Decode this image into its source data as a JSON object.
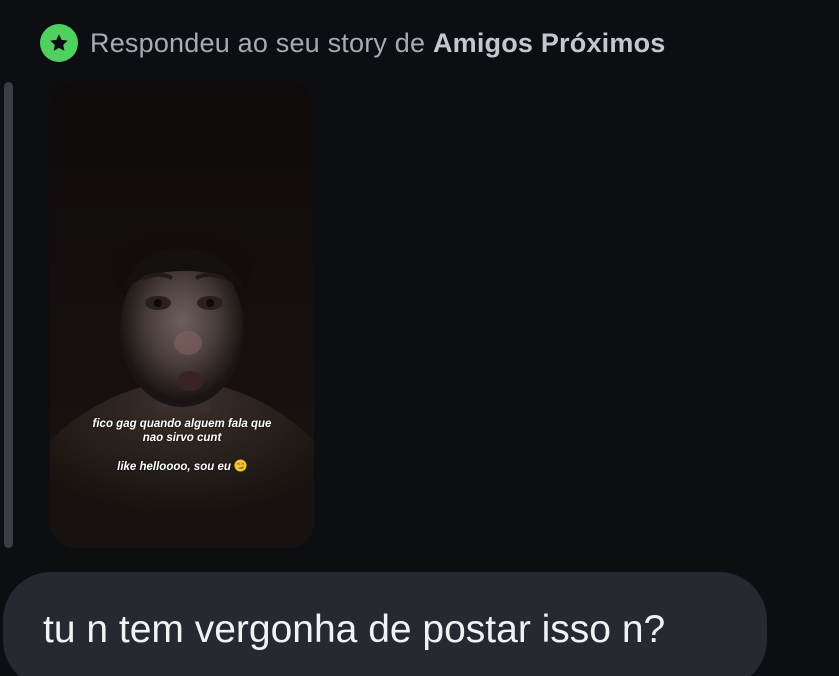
{
  "reply_header": {
    "prefix": "Respondeu ao seu story de",
    "audience": "Amigos Próximos",
    "badge_icon": "star-icon",
    "badge_color": "#4ed15f"
  },
  "story": {
    "caption_line_1": "fico gag quando alguem fala que",
    "caption_line_2": "nao sirvo cunt",
    "caption_line_3": "like helloooo, sou eu",
    "caption_emoji_icon": "smirk-emoji-icon"
  },
  "message": {
    "text": "tu n tem vergonha de postar isso n?"
  }
}
